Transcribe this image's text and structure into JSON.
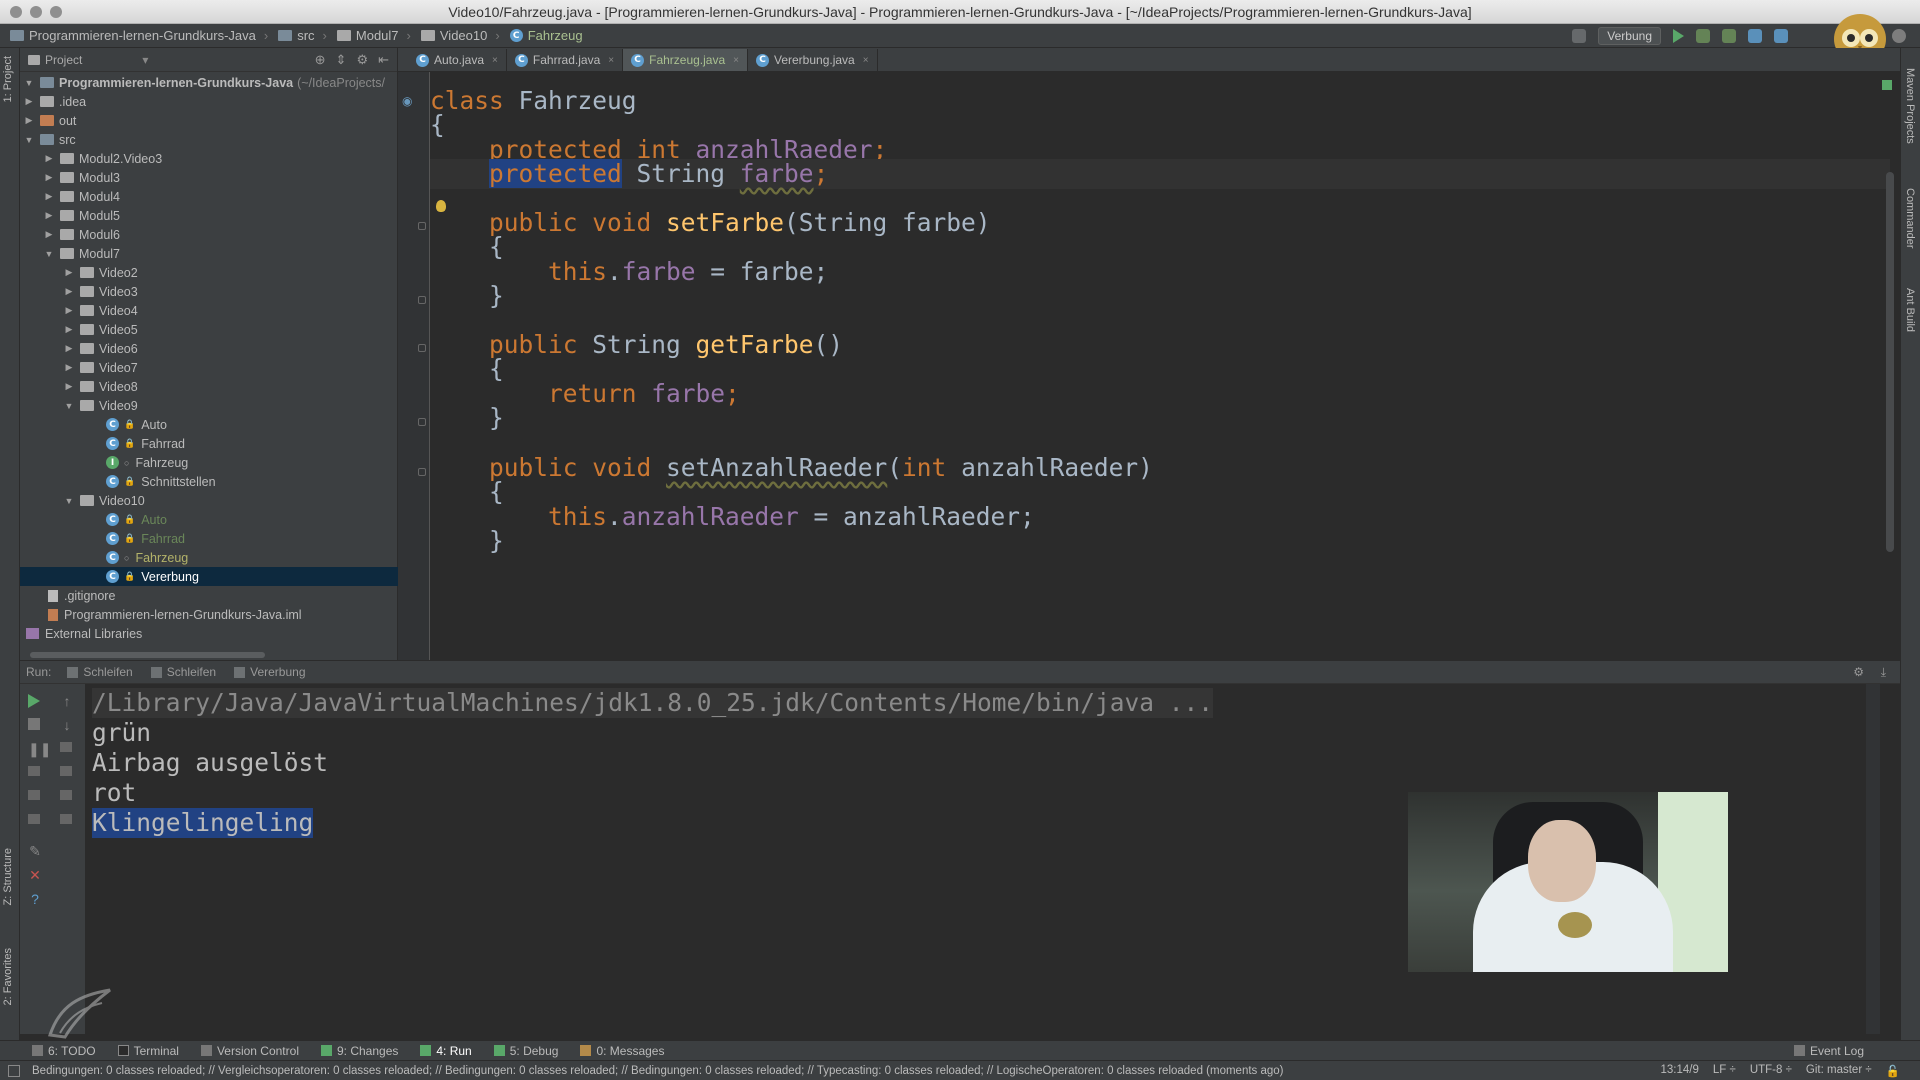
{
  "window": {
    "title": "Video10/Fahrzeug.java - [Programmieren-lernen-Grundkurs-Java] - Programmieren-lernen-Grundkurs-Java - [~/IdeaProjects/Programmieren-lernen-Grundkurs-Java]"
  },
  "breadcrumb": [
    "Programmieren-lernen-Grundkurs-Java",
    "src",
    "Modul7",
    "Video10",
    "Fahrzeug"
  ],
  "toolbar": {
    "run_config": "Verbung"
  },
  "left_tabs": {
    "project": "1: Project",
    "structure": "Z: Structure",
    "favorites": "2: Favorites"
  },
  "right_tabs": {
    "maven": "Maven Projects",
    "commander": "Commander",
    "ant": "Ant Build"
  },
  "project_panel": {
    "header": "Project",
    "root_label": "Programmieren-lernen-Grundkurs-Java",
    "root_path": "(~/IdeaProjects/",
    "items": {
      "idea": ".idea",
      "out": "out",
      "src": "src",
      "m2v3": "Modul2.Video3",
      "m3": "Modul3",
      "m4": "Modul4",
      "m5": "Modul5",
      "m6": "Modul6",
      "m7": "Modul7",
      "v2": "Video2",
      "v3": "Video3",
      "v4": "Video4",
      "v5": "Video5",
      "v6": "Video6",
      "v7": "Video7",
      "v8": "Video8",
      "v9": "Video9",
      "v9_auto": "Auto",
      "v9_fahrrad": "Fahrrad",
      "v9_fahrzeug": "Fahrzeug",
      "v9_schnitt": "Schnittstellen",
      "v10": "Video10",
      "v10_auto": "Auto",
      "v10_fahrrad": "Fahrrad",
      "v10_fahrzeug": "Fahrzeug",
      "v10_vererbung": "Vererbung",
      "gitignore": ".gitignore",
      "iml": "Programmieren-lernen-Grundkurs-Java.iml",
      "extlib": "External Libraries"
    }
  },
  "editor_tabs": [
    "Auto.java",
    "Fahrrad.java",
    "Fahrzeug.java",
    "Vererbung.java"
  ],
  "code": {
    "l1_kw": "class",
    "l1_name": " Fahrzeug",
    "l2": "{",
    "l3_kw": "    protected int",
    "l3_fld": "anzahlRaeder",
    "l3_end": ";",
    "l4_sel": "protected",
    "l4_type": " String ",
    "l4_fld": "farbe",
    "l4_end": ";",
    "l6_kw": "    public void ",
    "l6_fn": "setFarbe",
    "l6_rest": "(String farbe)",
    "l7": "    {",
    "l8_kw": "        this",
    "l8_dot": ".",
    "l8_fld": "farbe",
    "l8_rest": " = farbe;",
    "l9": "    }",
    "l11_kw": "    public ",
    "l11_type": "String ",
    "l11_fn": "getFarbe",
    "l11_rest": "()",
    "l12": "    {",
    "l13_kw": "        return ",
    "l13_fld": "farbe",
    "l13_end": ";",
    "l14": "    }",
    "l16_kw": "    public void ",
    "l16_fn": "setAnzahlRaeder",
    "l16_p1": "(",
    "l16_int": "int",
    "l16_p2": " anzahlRaeder)",
    "l17": "    {",
    "l18_kw": "        this",
    "l18_dot": ".",
    "l18_fld": "anzahlRaeder",
    "l18_rest": " = anzahlRaeder;",
    "l19": "    }"
  },
  "run_panel": {
    "label": "Run:",
    "tabs": [
      "Schleifen",
      "Schleifen",
      "Vererbung"
    ],
    "output": {
      "cmd": "/Library/Java/JavaVirtualMachines/jdk1.8.0_25.jdk/Contents/Home/bin/java ...",
      "line1": "grün",
      "line2": "Airbag ausgelöst",
      "line3": "rot",
      "line4": "Klingelingeling"
    }
  },
  "bottom_tools": [
    "6: TODO",
    "Terminal",
    "Version Control",
    "9: Changes",
    "4: Run",
    "5: Debug",
    "0: Messages"
  ],
  "event_log": "Event Log",
  "status": {
    "message": "Bedingungen: 0 classes reloaded; // Vergleichsoperatoren: 0 classes reloaded; // Bedingungen: 0 classes reloaded; // Bedingungen: 0 classes reloaded; // Typecasting: 0 classes reloaded; // LogischeOperatoren: 0 classes reloaded (moments ago)",
    "position": "13:14/9",
    "line_sep": "LF ÷",
    "encoding": "UTF-8 ÷",
    "vcs": "Git: master ÷"
  },
  "colors": {
    "keyword": "#cc7832",
    "field": "#9876aa",
    "method": "#ffc66d",
    "text": "#a9b7c6",
    "selection": "#214283",
    "background": "#2b2b2b"
  }
}
